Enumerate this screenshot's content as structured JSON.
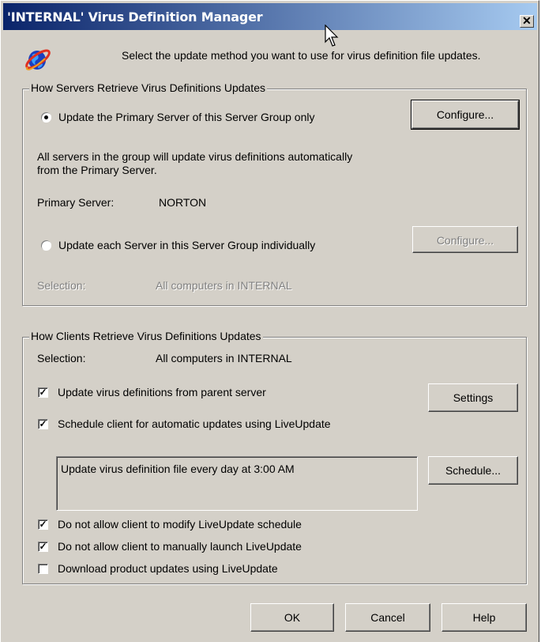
{
  "window": {
    "title": "'INTERNAL' Virus Definition Manager",
    "close_glyph": "✕",
    "intro_text": "Select the update method you want to use for virus definition file updates."
  },
  "servers": {
    "legend": "How Servers Retrieve Virus Definitions Updates",
    "option_primary": "Update the Primary Server of this Server Group only",
    "option_primary_selected": true,
    "configure_primary": "Configure...",
    "description_line1": "All servers in the group will update virus definitions automatically",
    "description_line2": "from the Primary Server.",
    "primary_server_label": "Primary Server:",
    "primary_server_value": "NORTON",
    "option_individual": "Update each Server in this Server Group individually",
    "option_individual_selected": false,
    "configure_individual": "Configure...",
    "selection_label": "Selection:",
    "selection_value": "All computers in INTERNAL"
  },
  "clients": {
    "legend": "How Clients Retrieve Virus Definitions Updates",
    "selection_label": "Selection:",
    "selection_value": "All computers in INTERNAL",
    "update_from_parent": "Update virus definitions from parent server",
    "update_from_parent_checked": true,
    "settings_button": "Settings",
    "schedule_liveupdate": "Schedule client for automatic updates using LiveUpdate",
    "schedule_liveupdate_checked": true,
    "schedule_text": "Update virus definition file every day at  3:00 AM",
    "schedule_button": "Schedule...",
    "no_modify": "Do not allow client to modify LiveUpdate schedule",
    "no_modify_checked": true,
    "no_manual": "Do not allow client to manually launch LiveUpdate",
    "no_manual_checked": true,
    "download_product": "Download product updates using LiveUpdate",
    "download_product_checked": false
  },
  "footer": {
    "ok": "OK",
    "cancel": "Cancel",
    "help": "Help"
  }
}
